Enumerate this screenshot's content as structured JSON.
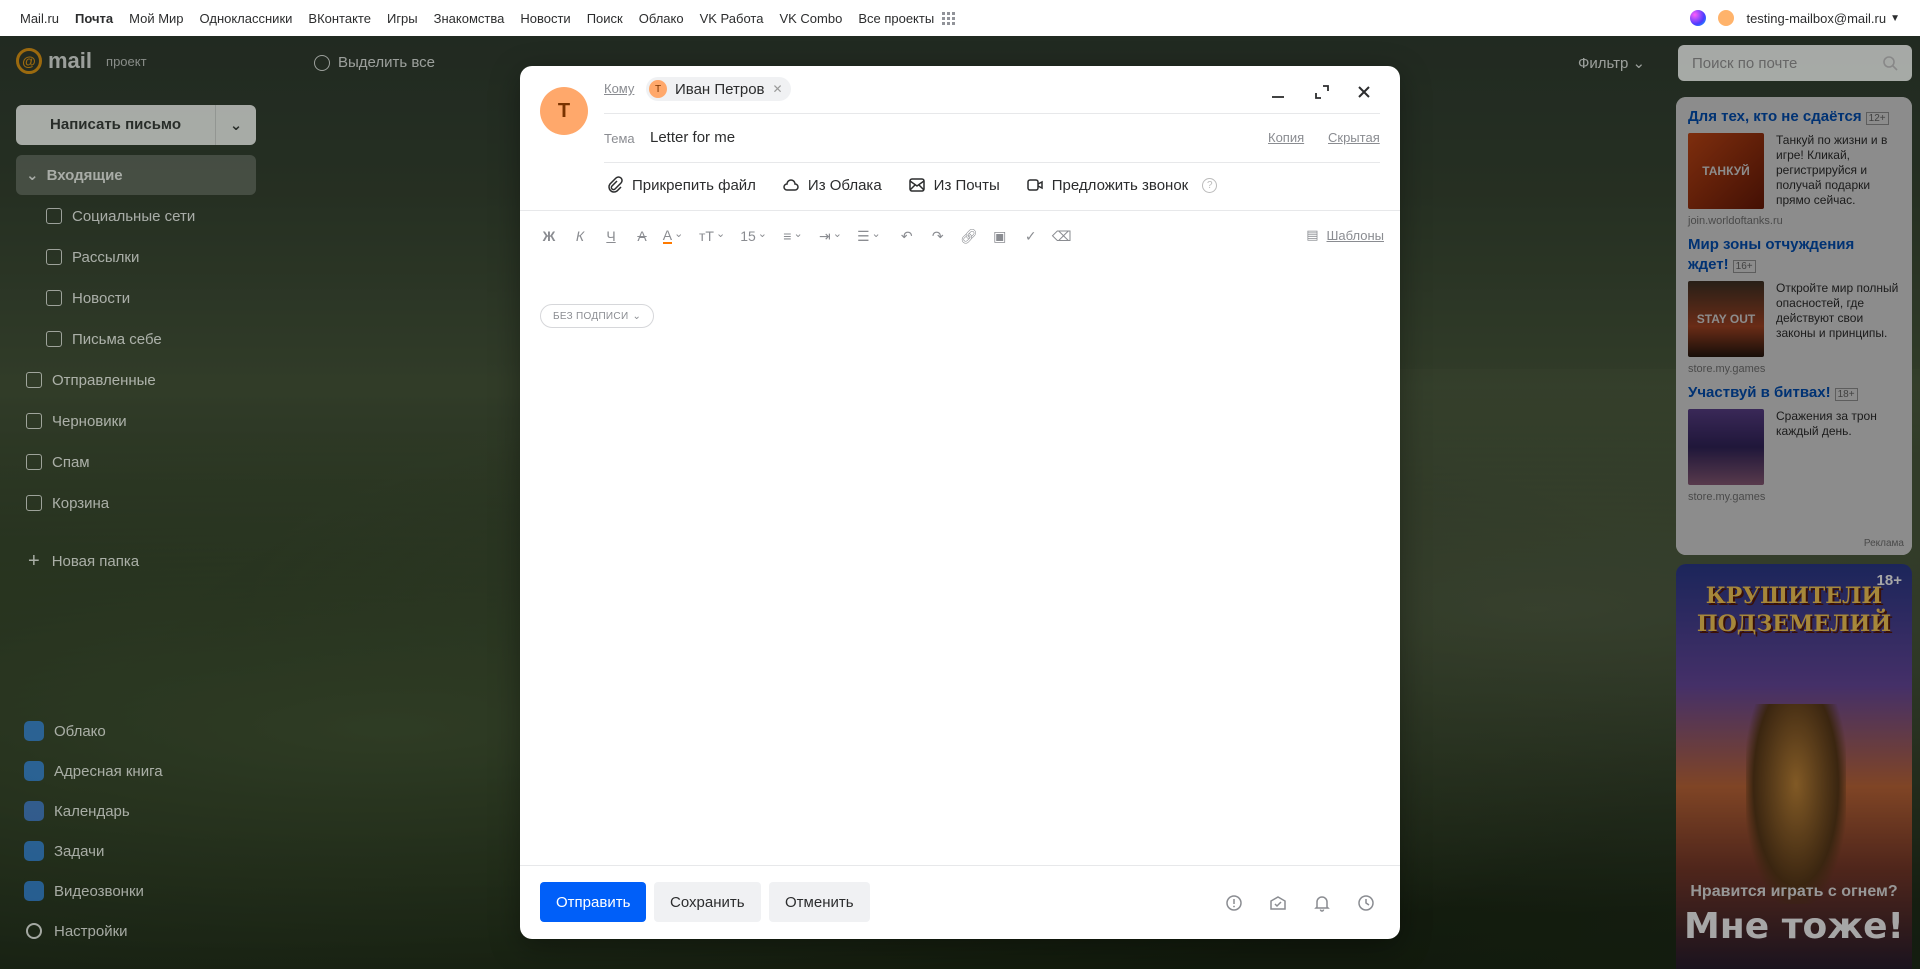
{
  "portal": {
    "links": [
      "Mail.ru",
      "Почта",
      "Мой Мир",
      "Одноклассники",
      "ВКонтакте",
      "Игры",
      "Знакомства",
      "Новости",
      "Поиск",
      "Облако",
      "VK Работа",
      "VK Combo",
      "Все проекты"
    ],
    "account": "testing-mailbox@mail.ru"
  },
  "header": {
    "logo": "mail",
    "project": "проект",
    "select_all": "Выделить все",
    "filter": "Фильтр",
    "search_placeholder": "Поиск по почте"
  },
  "sidebar": {
    "compose": "Написать письмо",
    "inbox": "Входящие",
    "sub": [
      "Социальные сети",
      "Рассылки",
      "Новости",
      "Письма себе"
    ],
    "folders": [
      "Отправленные",
      "Черновики",
      "Спам",
      "Корзина"
    ],
    "new_folder": "Новая папка",
    "apps": [
      "Облако",
      "Адресная книга",
      "Календарь",
      "Задачи",
      "Видеозвонки",
      "Настройки"
    ]
  },
  "ads": [
    {
      "title": "Для тех, кто не сдаётся",
      "age": "12+",
      "text": "Танкуй по жизни и в игре! Кликай, регистрируйся и получай подарки прямо сейчас.",
      "source": "join.worldoftanks.ru",
      "img": "ТАНКУЙ"
    },
    {
      "title": "Мир зоны отчуждения ждет!",
      "age": "16+",
      "text": "Откройте мир полный опасностей, где действуют свои законы и принципы.",
      "source": "store.my.games",
      "img": "STAY OUT"
    },
    {
      "title": "Участвуй в битвах!",
      "age": "18+",
      "text": "Сражения за трон каждый день.",
      "source": "store.my.games",
      "img": ""
    }
  ],
  "ads_label": "Реклама",
  "banner": {
    "title": "КРУШИТЕЛИ ПОДЗЕМЕЛИЙ",
    "age": "18+",
    "line1": "Нравится играть с огнем?",
    "line2": "Мне тоже!"
  },
  "compose": {
    "avatar_letter": "Т",
    "to_label": "Кому",
    "recipient": "Иван Петров",
    "recipient_initial": "Т",
    "subject_label": "Тема",
    "subject": "Letter for me",
    "cc": "Копия",
    "bcc": "Скрытая",
    "attach_file": "Прикрепить файл",
    "from_cloud": "Из Облака",
    "from_mail": "Из Почты",
    "suggest_call": "Предложить звонок",
    "font_size": "15",
    "templates": "Шаблоны",
    "signature": "БЕЗ ПОДПИСИ",
    "send": "Отправить",
    "save": "Сохранить",
    "cancel": "Отменить"
  },
  "colors": {
    "primary": "#005ff9",
    "avatar": "#ffa86b",
    "link": "#005bd1"
  }
}
